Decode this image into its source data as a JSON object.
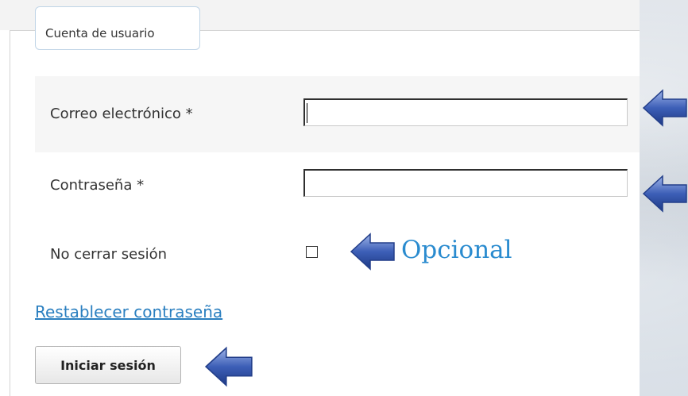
{
  "form": {
    "legend": "Cuenta de usuario",
    "email_label": "Correo electrónico *",
    "email_value": "",
    "password_label": "Contraseña *",
    "password_value": "",
    "remember_label": "No cerrar sesión",
    "optional_label": "Opcional",
    "reset_link": "Restablecer contraseña",
    "login_button": "Iniciar sesión"
  },
  "colors": {
    "accent": "#2a8bcf",
    "link": "#2a7fc0",
    "arrow": "#3d5fb7"
  }
}
